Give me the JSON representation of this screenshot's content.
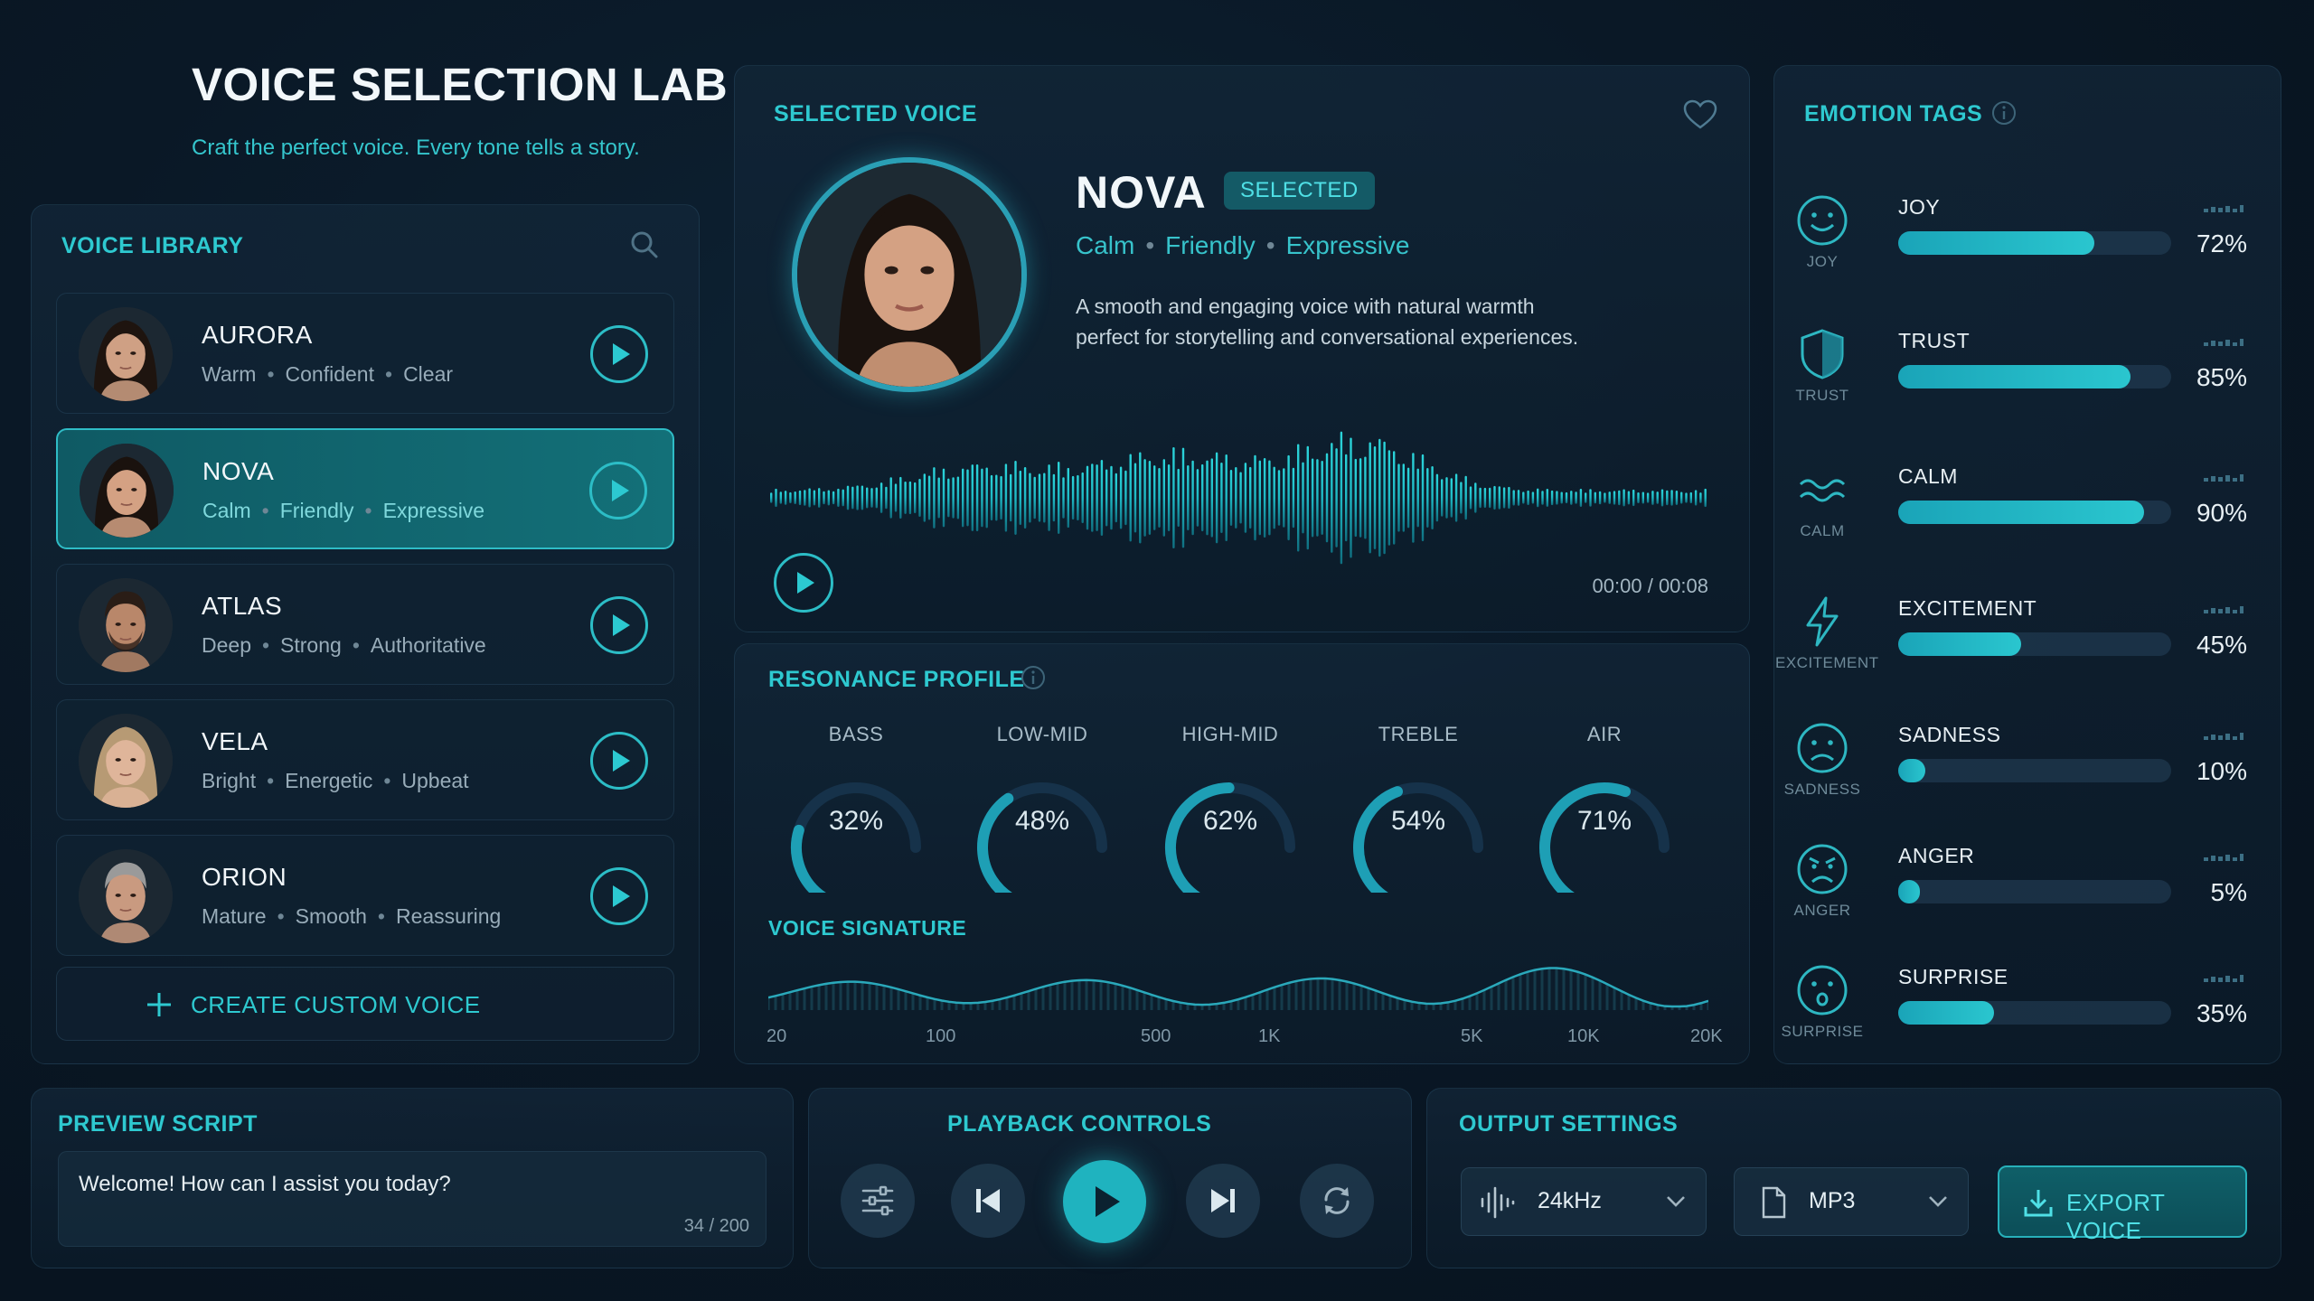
{
  "app": {
    "title": "VOICE SELECTION LAB",
    "subtitle": "Craft the perfect voice. Every tone tells a story."
  },
  "library": {
    "title": "VOICE LIBRARY",
    "search_icon": "search-icon",
    "voices": [
      {
        "name": "AURORA",
        "tags": [
          "Warm",
          "Confident",
          "Clear"
        ],
        "active": false
      },
      {
        "name": "NOVA",
        "tags": [
          "Calm",
          "Friendly",
          "Expressive"
        ],
        "active": true
      },
      {
        "name": "ATLAS",
        "tags": [
          "Deep",
          "Strong",
          "Authoritative"
        ],
        "active": false
      },
      {
        "name": "VELA",
        "tags": [
          "Bright",
          "Energetic",
          "Upbeat"
        ],
        "active": false
      },
      {
        "name": "ORION",
        "tags": [
          "Mature",
          "Smooth",
          "Reassuring"
        ],
        "active": false
      }
    ],
    "create_label": "CREATE CUSTOM VOICE"
  },
  "selected": {
    "title": "SELECTED VOICE",
    "name": "NOVA",
    "badge": "SELECTED",
    "tags": [
      "Calm",
      "Friendly",
      "Expressive"
    ],
    "description_line1": "A smooth and engaging voice with natural warmth",
    "description_line2": "perfect for storytelling and conversational experiences.",
    "time": "00:00 / 00:08",
    "favorite_icon": "heart-icon"
  },
  "resonance": {
    "title": "RESONANCE PROFILE",
    "bands": [
      {
        "label": "BASS",
        "value": "32%",
        "pct": 32
      },
      {
        "label": "LOW-MID",
        "value": "48%",
        "pct": 48
      },
      {
        "label": "HIGH-MID",
        "value": "62%",
        "pct": 62
      },
      {
        "label": "TREBLE",
        "value": "54%",
        "pct": 54
      },
      {
        "label": "AIR",
        "value": "71%",
        "pct": 71
      }
    ],
    "signature_title": "VOICE SIGNATURE",
    "freq_labels": [
      "20",
      "100",
      "500",
      "1K",
      "5K",
      "10K",
      "20K"
    ]
  },
  "emotions": {
    "title": "EMOTION TAGS",
    "items": [
      {
        "name": "JOY",
        "label": "JOY",
        "value": "72%",
        "pct": 72,
        "icon": "smile-icon"
      },
      {
        "name": "TRUST",
        "label": "TRUST",
        "value": "85%",
        "pct": 85,
        "icon": "shield-icon"
      },
      {
        "name": "CALM",
        "label": "CALM",
        "value": "90%",
        "pct": 90,
        "icon": "waves-icon"
      },
      {
        "name": "EXCITEMENT",
        "label": "EXCITEMENT",
        "value": "45%",
        "pct": 45,
        "icon": "lightning-icon"
      },
      {
        "name": "SADNESS",
        "label": "SADNESS",
        "value": "10%",
        "pct": 10,
        "icon": "sad-face-icon"
      },
      {
        "name": "ANGER",
        "label": "ANGER",
        "value": "5%",
        "pct": 5,
        "icon": "angry-face-icon"
      },
      {
        "name": "SURPRISE",
        "label": "SURPRISE",
        "value": "35%",
        "pct": 35,
        "icon": "surprised-face-icon"
      }
    ]
  },
  "preview": {
    "title": "PREVIEW SCRIPT",
    "text": "Welcome! How can I assist you today?",
    "count": "34 / 200"
  },
  "playback": {
    "title": "PLAYBACK CONTROLS"
  },
  "output": {
    "title": "OUTPUT SETTINGS",
    "sample_rate": "24kHz",
    "format": "MP3",
    "export_label": "EXPORT VOICE"
  },
  "colors": {
    "accent": "#2ec9d0",
    "background": "#0a1826",
    "active_card": "#137078"
  }
}
